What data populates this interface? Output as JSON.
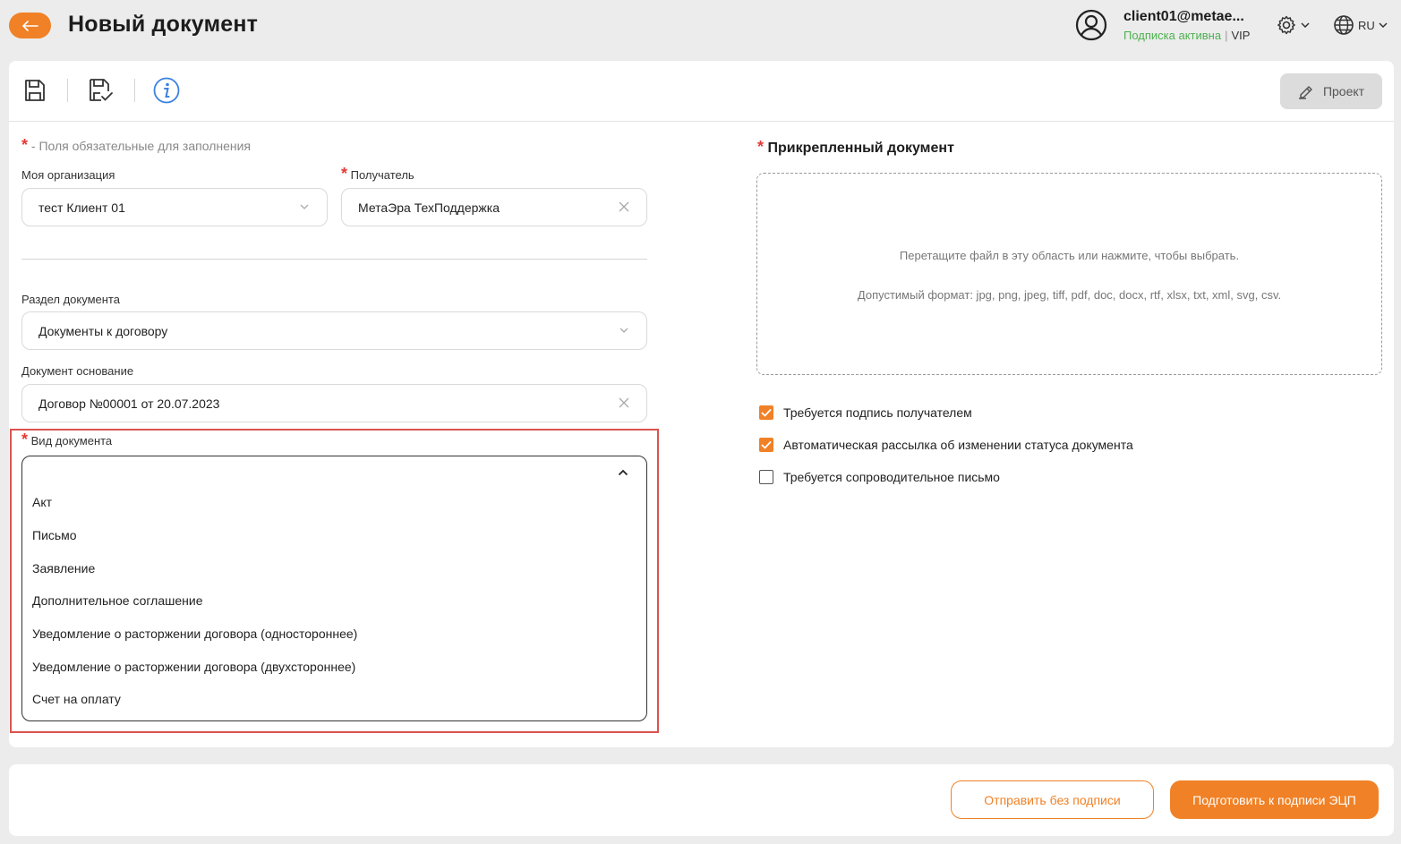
{
  "header": {
    "title": "Новый документ",
    "user_email": "client01@metae...",
    "subscription_status": "Подписка активна",
    "separator": "|",
    "plan": "VIP",
    "language": "RU"
  },
  "toolbar": {
    "project_label": "Проект"
  },
  "form": {
    "required_star": "*",
    "required_note": "- Поля обязательные для заполнения",
    "organization_label": "Моя организация",
    "organization_value": "тест Клиент 01",
    "recipient_label": "Получатель",
    "recipient_value": "МетаЭра ТехПоддержка",
    "section_label": "Раздел документа",
    "section_value": "Документы к договору",
    "basis_label": "Документ основание",
    "basis_value": "Договор №00001 от 20.07.2023",
    "doc_type_label": "Вид документа",
    "doc_type_options": [
      "Акт",
      "Письмо",
      "Заявление",
      "Дополнительное соглашение",
      "Уведомление о расторжении договора (одностороннее)",
      "Уведомление о расторжении договора (двухстороннее)",
      "Счет на оплату"
    ]
  },
  "attachment": {
    "title": "Прикрепленный документ",
    "drop_hint": "Перетащите файл в эту область или нажмите, чтобы выбрать.",
    "formats": "Допустимый формат: jpg, png, jpeg, tiff, pdf, doc, docx, rtf, xlsx, txt, xml, svg, csv."
  },
  "options": [
    {
      "label": "Требуется подпись получателем",
      "checked": true
    },
    {
      "label": "Автоматическая рассылка об изменении статуса документа",
      "checked": true
    },
    {
      "label": "Требуется сопроводительное письмо",
      "checked": false
    }
  ],
  "footer": {
    "send_unsigned_label": "Отправить без подписи",
    "prepare_sign_label": "Подготовить к подписи ЭЦП"
  },
  "colors": {
    "accent": "#f08126",
    "required": "#e53935",
    "success": "#4cb050",
    "highlight": "#d9534f"
  }
}
